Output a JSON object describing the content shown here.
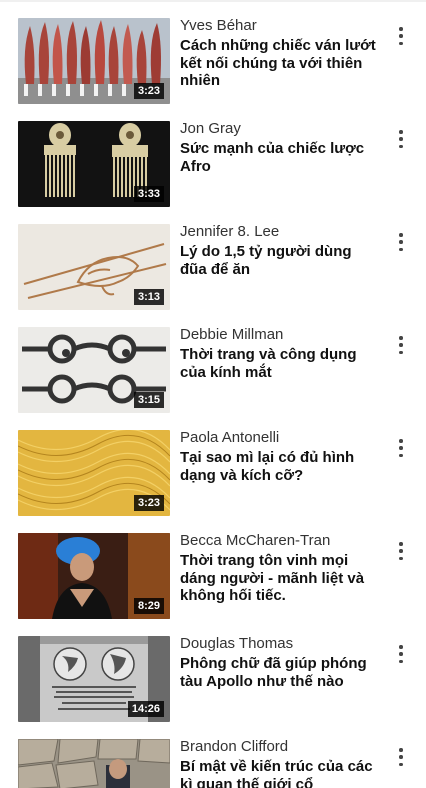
{
  "videos": [
    {
      "speaker": "Yves Béhar",
      "title": "Cách những chiếc ván lướt kết nối chúng ta với thiên nhiên",
      "duration": "3:23",
      "thumb_icon": "surfboards-thumbnail"
    },
    {
      "speaker": "Jon Gray",
      "title": "Sức mạnh của chiếc lược Afro",
      "duration": "3:33",
      "thumb_icon": "afro-combs-thumbnail"
    },
    {
      "speaker": "Jennifer 8. Lee",
      "title": "Lý do 1,5 tỷ người dùng đũa để ăn",
      "duration": "3:13",
      "thumb_icon": "chopsticks-hand-thumbnail"
    },
    {
      "speaker": "Debbie Millman",
      "title": "Thời trang và công dụng của kính mắt",
      "duration": "3:15",
      "thumb_icon": "eyeglasses-thumbnail"
    },
    {
      "speaker": "Paola Antonelli",
      "title": "Tại  sao mì lại có đủ hình dạng và kích cỡ?",
      "duration": "3:23",
      "thumb_icon": "noodles-thumbnail"
    },
    {
      "speaker": "Becca McCharen-Tran",
      "title": "Thời trang tôn vinh mọi dáng người - mãnh liệt và không hối tiếc.",
      "duration": "8:29",
      "thumb_icon": "speaker-stage-thumbnail"
    },
    {
      "speaker": "Douglas Thomas",
      "title": "Phông chữ đã giúp phóng tàu Apollo như thế nào",
      "duration": "14:26",
      "thumb_icon": "apollo-plaque-thumbnail"
    },
    {
      "speaker": "Brandon Clifford",
      "title": "Bí mật về kiến trúc của các kì quan thế giới cổ",
      "duration": "",
      "thumb_icon": "stone-wall-thumbnail"
    }
  ],
  "more_icon": "more-vertical-icon"
}
